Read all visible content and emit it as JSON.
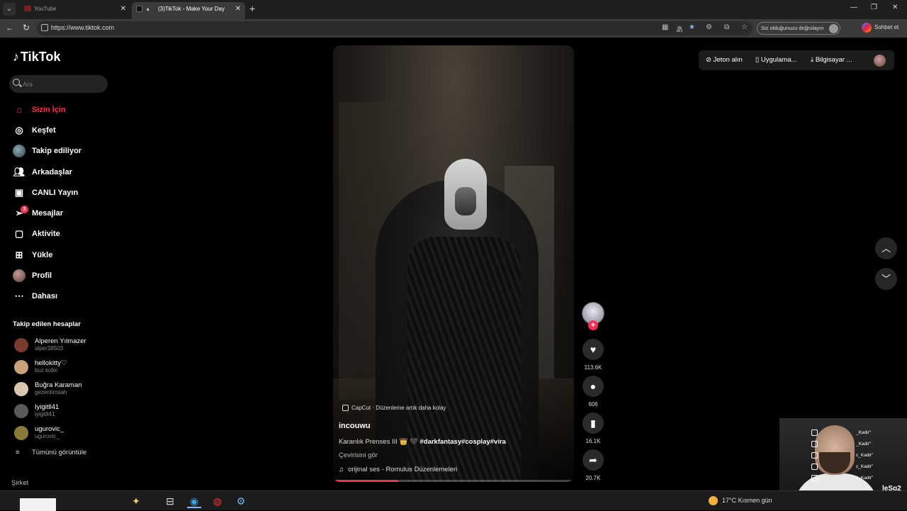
{
  "browser": {
    "tabs": [
      {
        "title": "YouTube",
        "active": false
      },
      {
        "title": "(3)TikTok - Make Your Day",
        "active": true
      }
    ],
    "url": "https://www.tiktok.com",
    "verify_text": "Siz olduğunuzu doğrulayın",
    "copilot_label": "Sohbet et"
  },
  "sidebar": {
    "logo": "TikTok",
    "search_placeholder": "Ara",
    "nav": [
      {
        "label": "Sizin İçin",
        "icon": "home-icon",
        "active": true
      },
      {
        "label": "Keşfet",
        "icon": "compass-icon"
      },
      {
        "label": "Takip ediliyor",
        "icon": "following-avatar"
      },
      {
        "label": "Arkadaşlar",
        "icon": "friends-icon"
      },
      {
        "label": "CANLI Yayın",
        "icon": "live-tv-icon"
      },
      {
        "label": "Mesajlar",
        "icon": "messages-icon",
        "badge": "3"
      },
      {
        "label": "Aktivite",
        "icon": "activity-icon"
      },
      {
        "label": "Yükle",
        "icon": "upload-icon"
      },
      {
        "label": "Profil",
        "icon": "profile-avatar"
      },
      {
        "label": "Dahası",
        "icon": "more-icon"
      }
    ],
    "following_title": "Takip edilen hesaplar",
    "following": [
      {
        "name": "Alperen Yılmazer",
        "username": "alper38503",
        "color": "#7a3b2e"
      },
      {
        "name": "hellokitty♡",
        "username": "buz kofei",
        "color": "#c9a27a"
      },
      {
        "name": "Buğra Karaman",
        "username": "gezentimsah",
        "color": "#d9c7b0"
      },
      {
        "name": "Iyigitll41",
        "username": "iyigitll41",
        "color": "#5a5a5a"
      },
      {
        "name": "ugurovic_",
        "username": "ugurovic_",
        "color": "#8a7a3a"
      }
    ],
    "see_all": "Tümünü görüntüle",
    "company": "Şirket"
  },
  "header": {
    "coins": "Jeton alın",
    "app": "Uygulama...",
    "desktop": "Bilgisayar ..."
  },
  "video": {
    "capcut_text": "CapCut · Düzenleme artık daha kolay",
    "author": "incouwu",
    "caption_text": "Karanlık Prenses III 👑 🖤",
    "caption_tags": "#darkfantasy#cosplay#vira",
    "translate": "Çevirisini gör",
    "sound": "orijinal ses - Romulus Düzenlemeleri",
    "progress": 0.27
  },
  "actions": {
    "likes": "113.6K",
    "comments": "606",
    "saves": "16.1K",
    "shares": "20.7K"
  },
  "overlay": {
    "chat_lines": [
      "_Kadir\"",
      "_Kadir\"",
      "c_Kadir\"",
      "c_Kadir\"",
      "c_Kadir\""
    ],
    "name": "leSg2"
  },
  "taskbar": {
    "weather": "17°C  Kısmen gün"
  }
}
